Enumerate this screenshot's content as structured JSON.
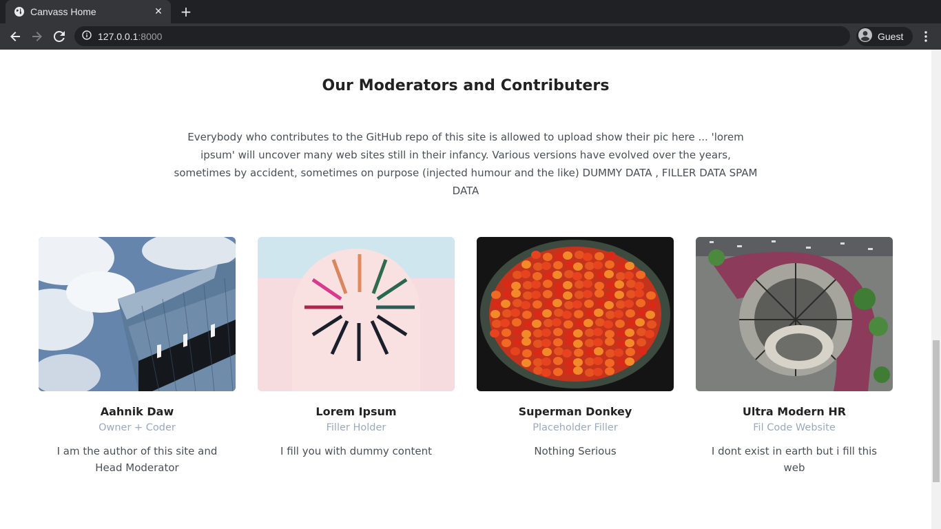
{
  "browser": {
    "tab_title": "Canvass Home",
    "close_glyph": "✕",
    "new_tab_glyph": "+",
    "url_host": "127.0.0.1",
    "url_port": ":8000",
    "profile_label": "Guest",
    "icons": [
      "globe-icon",
      "close-icon",
      "plus-icon",
      "back-arrow-icon",
      "forward-arrow-icon",
      "reload-icon",
      "info-icon",
      "account-icon",
      "kebab-menu-icon"
    ]
  },
  "section": {
    "heading": "Our Moderators and Contributers",
    "intro": "Everybody who contributes to the GitHub repo of this site is allowed to upload show their pic here ... 'lorem ipsum' will uncover many web sites still in their infancy. Various versions have evolved over the years, sometimes by accident, sometimes on purpose (injected humour and the like) DUMMY DATA , FILLER DATA SPAM DATA"
  },
  "members": [
    {
      "name": "Aahnik Daw",
      "role": "Owner + Coder",
      "description": "I am the author of this site and Head Moderator",
      "image": "skyscraper-clouds-photo"
    },
    {
      "name": "Lorem Ipsum",
      "role": "Filler Holder",
      "description": "I fill you with dummy content",
      "image": "pink-arch-sunburst-photo"
    },
    {
      "name": "Superman Donkey",
      "role": "Placeholder Filler",
      "description": "Nothing Serious",
      "image": "tomatoes-basket-photo"
    },
    {
      "name": "Ultra Modern HR",
      "role": "Fil Code Website",
      "description": "I dont exist in earth but i fill this web",
      "image": "aerial-building-photo"
    }
  ],
  "colors": {
    "chrome_dark": "#202124",
    "chrome_tab": "#35363a",
    "role_text": "#9aa9bd",
    "body_text": "#4a4f55",
    "heading_text": "#222222"
  }
}
